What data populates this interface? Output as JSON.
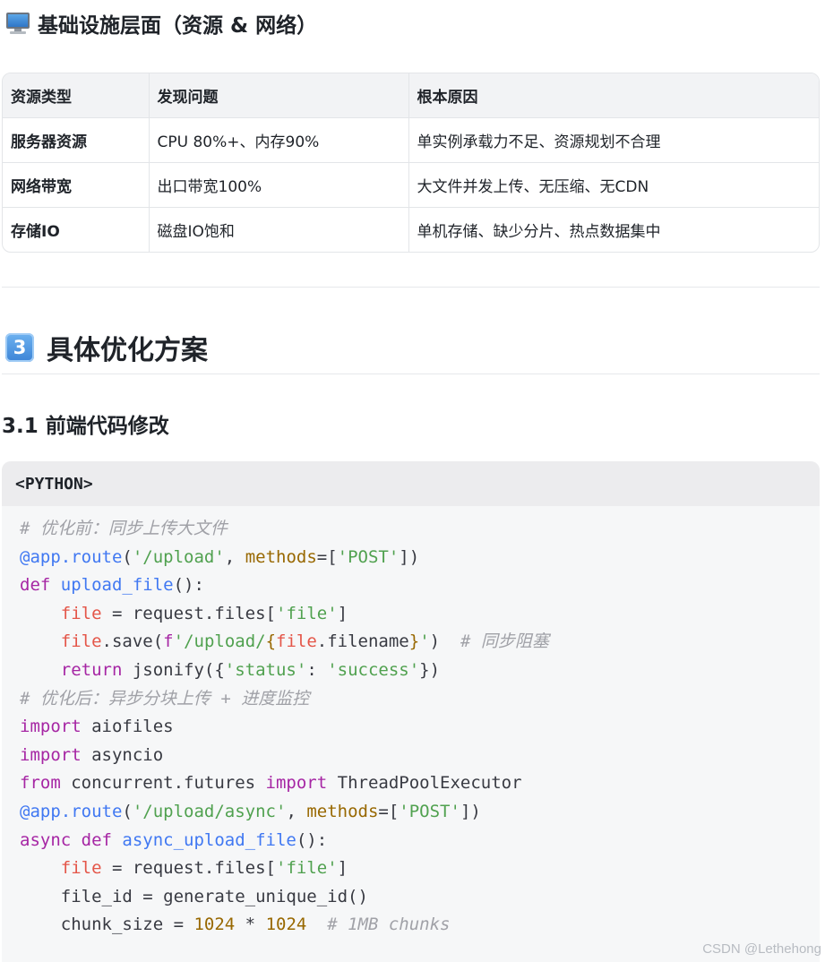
{
  "section_infra": {
    "icon": "desktop-computer-icon",
    "title": "基础设施层面（资源 & 网络）",
    "table": {
      "headers": [
        "资源类型",
        "发现问题",
        "根本原因"
      ],
      "rows": [
        [
          "服务器资源",
          "CPU 80%+、内存90%",
          "单实例承载力不足、资源规划不合理"
        ],
        [
          "网络带宽",
          "出口带宽100%",
          "大文件并发上传、无压缩、无CDN"
        ],
        [
          "存储IO",
          "磁盘IO饱和",
          "单机存储、缺少分片、热点数据集中"
        ]
      ]
    }
  },
  "section_plan": {
    "number_badge": "3",
    "icon": "keycap-digit-three-icon",
    "title": "具体优化方案"
  },
  "subsection": {
    "title": "3.1 前端代码修改"
  },
  "code_block": {
    "language_label": "<PYTHON>",
    "lines": [
      [
        [
          "comment",
          "# 优化前：同步上传大文件"
        ]
      ],
      [
        [
          "func",
          "@app.route"
        ],
        [
          "plain",
          "("
        ],
        [
          "string",
          "'/upload'"
        ],
        [
          "plain",
          ", "
        ],
        [
          "attr",
          "methods"
        ],
        [
          "plain",
          "=["
        ],
        [
          "string",
          "'POST'"
        ],
        [
          "plain",
          "])"
        ]
      ],
      [
        [
          "keyword",
          "def "
        ],
        [
          "func",
          "upload_file"
        ],
        [
          "plain",
          "():"
        ]
      ],
      [
        [
          "plain",
          "    "
        ],
        [
          "var",
          "file"
        ],
        [
          "plain",
          " = request.files["
        ],
        [
          "string",
          "'file'"
        ],
        [
          "plain",
          "]"
        ]
      ],
      [
        [
          "plain",
          "    "
        ],
        [
          "var",
          "file"
        ],
        [
          "plain",
          ".save("
        ],
        [
          "keyword",
          "f"
        ],
        [
          "string",
          "'/upload/"
        ],
        [
          "attr",
          "{"
        ],
        [
          "var",
          "file"
        ],
        [
          "plain",
          ".filename"
        ],
        [
          "attr",
          "}"
        ],
        [
          "string",
          "'"
        ],
        [
          "plain",
          ")  "
        ],
        [
          "comment",
          "# 同步阻塞"
        ]
      ],
      [
        [
          "plain",
          "    "
        ],
        [
          "keyword",
          "return "
        ],
        [
          "plain",
          "jsonify({"
        ],
        [
          "string",
          "'status'"
        ],
        [
          "plain",
          ": "
        ],
        [
          "string",
          "'success'"
        ],
        [
          "plain",
          "})"
        ]
      ],
      [
        [
          "comment",
          "# 优化后：异步分块上传 + 进度监控"
        ]
      ],
      [
        [
          "keyword",
          "import "
        ],
        [
          "plain",
          "aiofiles"
        ]
      ],
      [
        [
          "keyword",
          "import "
        ],
        [
          "plain",
          "asyncio"
        ]
      ],
      [
        [
          "keyword",
          "from "
        ],
        [
          "plain",
          "concurrent.futures "
        ],
        [
          "keyword",
          "import "
        ],
        [
          "plain",
          "ThreadPoolExecutor"
        ]
      ],
      [
        [
          "func",
          "@app.route"
        ],
        [
          "plain",
          "("
        ],
        [
          "string",
          "'/upload/async'"
        ],
        [
          "plain",
          ", "
        ],
        [
          "attr",
          "methods"
        ],
        [
          "plain",
          "=["
        ],
        [
          "string",
          "'POST'"
        ],
        [
          "plain",
          "])"
        ]
      ],
      [
        [
          "keyword",
          "async def "
        ],
        [
          "func",
          "async_upload_file"
        ],
        [
          "plain",
          "():"
        ]
      ],
      [
        [
          "plain",
          "    "
        ],
        [
          "var",
          "file"
        ],
        [
          "plain",
          " = request.files["
        ],
        [
          "string",
          "'file'"
        ],
        [
          "plain",
          "]"
        ]
      ],
      [
        [
          "plain",
          "    file_id = generate_unique_id()"
        ]
      ],
      [
        [
          "plain",
          "    chunk_size = "
        ],
        [
          "number",
          "1024"
        ],
        [
          "plain",
          " * "
        ],
        [
          "number",
          "1024"
        ],
        [
          "plain",
          "  "
        ],
        [
          "comment",
          "# 1MB chunks"
        ]
      ]
    ]
  },
  "watermark": "CSDN @Lethehong"
}
